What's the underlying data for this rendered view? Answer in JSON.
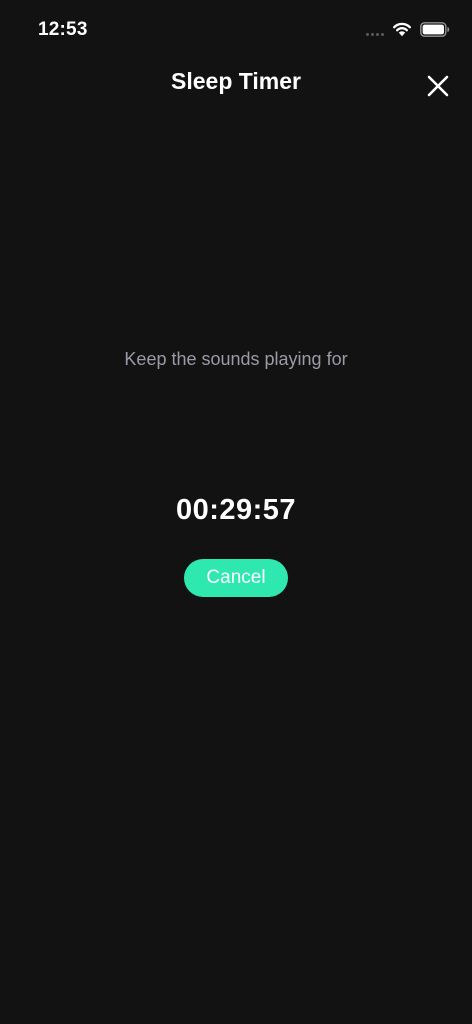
{
  "status_bar": {
    "time": "12:53",
    "icons": [
      "signal-dots-icon",
      "wifi-icon",
      "battery-icon"
    ]
  },
  "header": {
    "title": "Sleep Timer",
    "close_icon": "close-icon"
  },
  "main": {
    "subtitle": "Keep the sounds playing for",
    "countdown": "00:29:57",
    "cancel_label": "Cancel"
  },
  "colors": {
    "background": "#121212",
    "accent": "#2ee8b0",
    "subtitle_text": "#9a9aa8",
    "text": "#ffffff"
  }
}
